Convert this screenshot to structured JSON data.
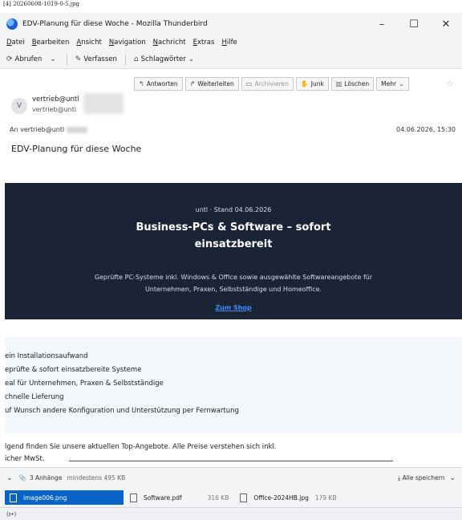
{
  "caption": "[4] 20260608-1019-0-5.jpg",
  "window": {
    "title": "EDV-Planung für diese Woche - Mozilla Thunderbird",
    "minimize": "–",
    "maximize": "☐",
    "close": "✕"
  },
  "menu": [
    "Datei",
    "Bearbeiten",
    "Ansicht",
    "Navigation",
    "Nachricht",
    "Extras",
    "Hilfe"
  ],
  "toolbar": {
    "get_mail": "Abrufen",
    "write": "Verfassen",
    "tags": "Schlagwörter"
  },
  "message": {
    "actions": [
      "Antworten",
      "Weiterleiten",
      "Archivieren",
      "Junk",
      "Löschen",
      "Mehr"
    ],
    "avatar_initial": "V",
    "from_name": "vertrieb@untl",
    "from_addr": "vertrieb@unti",
    "to_label": "An",
    "to_value": "vertrieb@untl",
    "date": "04.06.2026, 15:30",
    "subject": "EDV-Planung für diese Woche"
  },
  "banner": {
    "stand": "untl · Stand 04.06.2026",
    "title_line1": "Business-PCs & Software – sofort",
    "title_line2": "einsatzbereit",
    "sub_line1": "Geprüfte PC-Systeme inkl. Windows & Office sowie ausgewählte Softwareangebote für",
    "sub_line2": "Unternehmen, Praxen, Selbstständige und Homeoffice.",
    "link": "Zum Shop"
  },
  "features": [
    "ein Installationsaufwand",
    "eprüfte & sofort einsatzbereite Systeme",
    "eal für Unternehmen, Praxen & Selbstständige",
    "chnelle Lieferung",
    "uf Wunsch andere Konfiguration und Unterstützung per Fernwartung"
  ],
  "intro": {
    "line1": "lgend finden Sie unsere aktuellen Top-Angebote. Alle Preise verstehen sich inkl.",
    "line2": "icher MwSt."
  },
  "attachments": {
    "summary": "3 Anhänge",
    "size_hint": "mindestens 495 KB",
    "save_all": "Alle speichern",
    "items": [
      {
        "name": "image006.png",
        "size": ""
      },
      {
        "name": "Software.pdf",
        "size": "316 KB"
      },
      {
        "name": "Office-2024HB.jpg",
        "size": "179 KB"
      }
    ]
  },
  "status": "(ɪ•)"
}
